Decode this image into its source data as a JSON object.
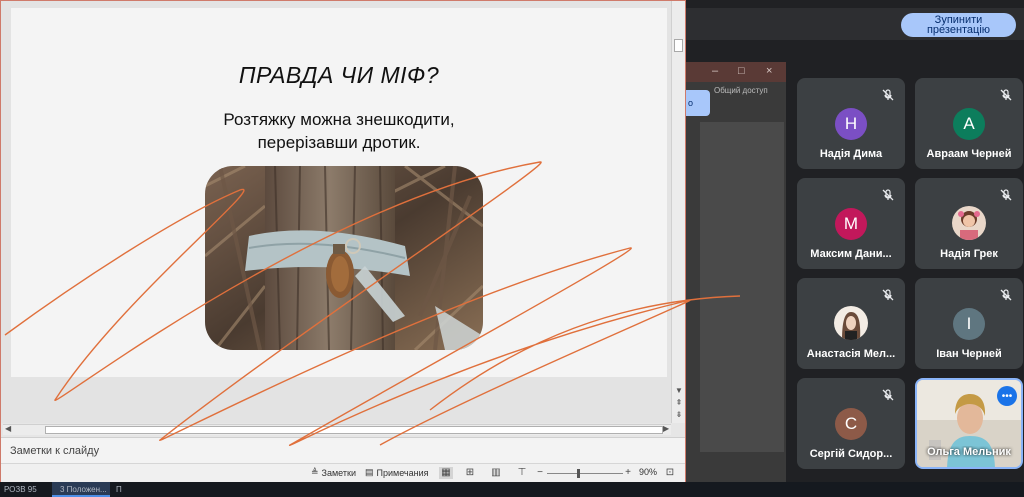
{
  "meet": {
    "stop_presenting_label": "Зупинити презентацію",
    "shared_window": {
      "share_label": "Общий доступ",
      "button_label": "о",
      "controls": [
        "–",
        "□",
        "×"
      ]
    }
  },
  "participants": [
    {
      "name": "Надія Дима",
      "initial": "Н",
      "color": "#7b4fc4",
      "muted": true
    },
    {
      "name": "Авраам Черней",
      "initial": "А",
      "color": "#0c7d5c",
      "muted": true
    },
    {
      "name": "Максим Дани...",
      "initial": "М",
      "color": "#c2185b",
      "muted": true
    },
    {
      "name": "Надія Грек",
      "initial": "",
      "color": "#c98b8b",
      "muted": true,
      "photo": true
    },
    {
      "name": "Анастасія Мел...",
      "initial": "",
      "color": "#d7c7b8",
      "muted": true,
      "photo": true
    },
    {
      "name": "Іван Черней",
      "initial": "І",
      "color": "#5f7680",
      "muted": true
    },
    {
      "name": "Сергій Сидор...",
      "initial": "С",
      "color": "#8d5a48",
      "muted": true
    },
    {
      "name": "Ольга Мельник",
      "initial": "",
      "color": "",
      "muted": false,
      "video": true
    }
  ],
  "slide": {
    "title": "ПРАВДА ЧИ МІФ?",
    "text_line1": "Розтяжку можна знешкодити,",
    "text_line2": "перерізавши дротик."
  },
  "ppt": {
    "notes_placeholder": "Заметки к слайду",
    "status": {
      "notes_label": "Заметки",
      "comments_label": "Примечания",
      "zoom": "90%"
    }
  },
  "taskbar": {
    "items": [
      "РОЗВ 95",
      "3 Положен...",
      "П"
    ]
  },
  "colors": {
    "accent_button": "#a8c7fa",
    "scribble": "#e0703c"
  }
}
